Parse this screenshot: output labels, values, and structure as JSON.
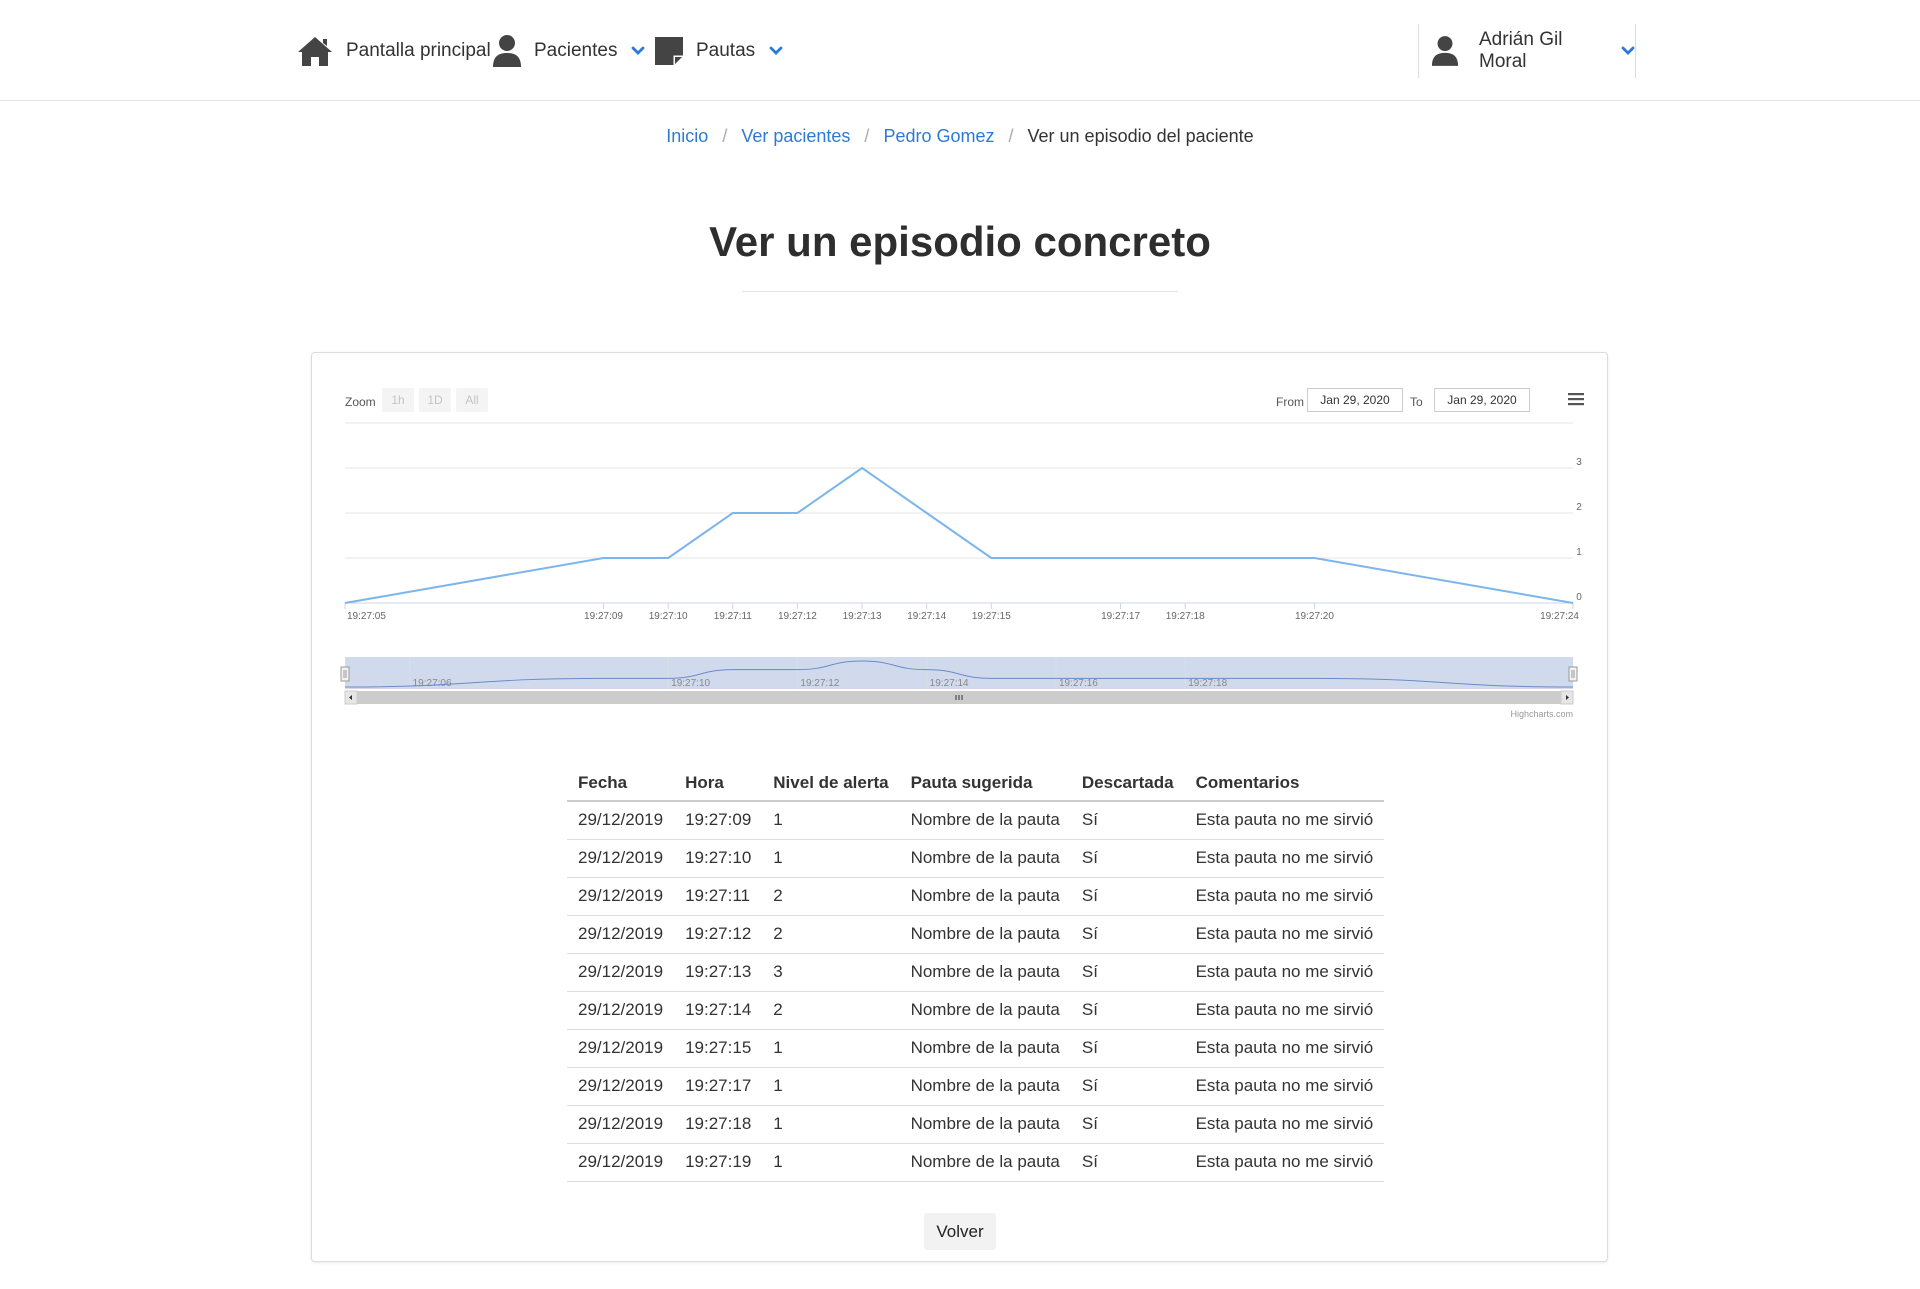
{
  "nav": {
    "home_label": "Pantalla principal",
    "pacientes_label": "Pacientes",
    "pautas_label": "Pautas",
    "user_name": "Adrián Gil Moral"
  },
  "breadcrumb": {
    "items": [
      "Inicio",
      "Ver pacientes",
      "Pedro Gomez"
    ],
    "current": "Ver un episodio del paciente"
  },
  "page_title": "Ver un episodio concreto",
  "chart_controls": {
    "zoom_label": "Zoom",
    "zoom_buttons": [
      "1h",
      "1D",
      "All"
    ],
    "from_label": "From",
    "from_value": "Jan 29, 2020",
    "to_label": "To",
    "to_value": "Jan 29, 2020",
    "credit": "Highcharts.com"
  },
  "chart_data": {
    "type": "line",
    "x": [
      "19:27:05",
      "19:27:09",
      "19:27:10",
      "19:27:11",
      "19:27:12",
      "19:27:13",
      "19:27:14",
      "19:27:15",
      "19:27:17",
      "19:27:18",
      "19:27:20",
      "19:27:24"
    ],
    "series": [
      {
        "values": [
          0,
          1,
          1,
          2,
          2,
          3,
          2,
          1,
          1,
          1,
          1,
          0
        ]
      }
    ],
    "x_ticks": [
      "19:27:05",
      "19:27:09",
      "19:27:10",
      "19:27:11",
      "19:27:12",
      "19:27:13",
      "19:27:14",
      "19:27:15",
      "19:27:17",
      "19:27:18",
      "19:27:20",
      "19:27:24"
    ],
    "y_ticks": [
      0,
      1,
      2,
      3
    ],
    "ylim": [
      0,
      4
    ],
    "navigator_ticks": [
      "19:27:06",
      "19:27:10",
      "19:27:12",
      "19:27:14",
      "19:27:16",
      "19:27:18"
    ],
    "line_color": "#7cb5ec",
    "grid": true
  },
  "table": {
    "headers": [
      "Fecha",
      "Hora",
      "Nivel de alerta",
      "Pauta sugerida",
      "Descartada",
      "Comentarios"
    ],
    "rows": [
      [
        "29/12/2019",
        "19:27:09",
        "1",
        "Nombre de la pauta",
        "Sí",
        "Esta pauta no me sirvió"
      ],
      [
        "29/12/2019",
        "19:27:10",
        "1",
        "Nombre de la pauta",
        "Sí",
        "Esta pauta no me sirvió"
      ],
      [
        "29/12/2019",
        "19:27:11",
        "2",
        "Nombre de la pauta",
        "Sí",
        "Esta pauta no me sirvió"
      ],
      [
        "29/12/2019",
        "19:27:12",
        "2",
        "Nombre de la pauta",
        "Sí",
        "Esta pauta no me sirvió"
      ],
      [
        "29/12/2019",
        "19:27:13",
        "3",
        "Nombre de la pauta",
        "Sí",
        "Esta pauta no me sirvió"
      ],
      [
        "29/12/2019",
        "19:27:14",
        "2",
        "Nombre de la pauta",
        "Sí",
        "Esta pauta no me sirvió"
      ],
      [
        "29/12/2019",
        "19:27:15",
        "1",
        "Nombre de la pauta",
        "Sí",
        "Esta pauta no me sirvió"
      ],
      [
        "29/12/2019",
        "19:27:17",
        "1",
        "Nombre de la pauta",
        "Sí",
        "Esta pauta no me sirvió"
      ],
      [
        "29/12/2019",
        "19:27:18",
        "1",
        "Nombre de la pauta",
        "Sí",
        "Esta pauta no me sirvió"
      ],
      [
        "29/12/2019",
        "19:27:19",
        "1",
        "Nombre de la pauta",
        "Sí",
        "Esta pauta no me sirvió"
      ]
    ]
  },
  "volver_label": "Volver",
  "colors": {
    "link": "#2d7ad6",
    "chevron": "#2d7ad6",
    "icon": "#444444",
    "navigator_fill": "#ccd6eb"
  }
}
